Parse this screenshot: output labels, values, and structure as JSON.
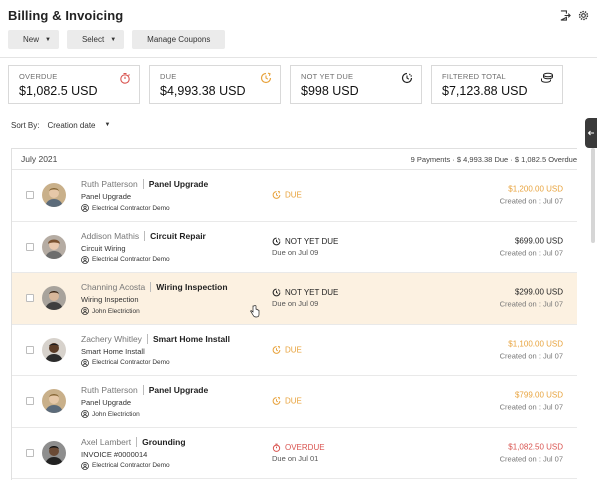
{
  "header": {
    "title": "Billing & Invoicing"
  },
  "toolbar": {
    "new_label": "New",
    "select_label": "Select",
    "coupons_label": "Manage Coupons"
  },
  "summary": [
    {
      "label": "OVERDUE",
      "value": "$1,082.5 USD",
      "icon": "stopwatch-icon",
      "color": "#d9534f"
    },
    {
      "label": "DUE",
      "value": "$4,993.38 USD",
      "icon": "clock-refresh-icon",
      "color": "#e8a33d"
    },
    {
      "label": "NOT YET DUE",
      "value": "$998 USD",
      "icon": "clock-pending-icon",
      "color": "#222222"
    },
    {
      "label": "FILTERED TOTAL",
      "value": "$7,123.88 USD",
      "icon": "coins-stack-icon",
      "color": "#222222"
    }
  ],
  "sort": {
    "label": "Sort By:",
    "value": "Creation date"
  },
  "group": {
    "title": "July 2021",
    "stats": "9 Payments  ·  $ 4,993.38 Due  ·  $ 1,082.5 Overdue"
  },
  "invoices": [
    {
      "name": "Ruth Patterson",
      "job": "Panel Upgrade",
      "sub": "Panel Upgrade",
      "org": "Electrical Contractor Demo",
      "status": "DUE",
      "due_date": "",
      "amount": "$1,200.00 USD",
      "created": "Created on : Jul 07"
    },
    {
      "name": "Addison Mathis",
      "job": "Circuit Repair",
      "sub": "Circuit Wiring",
      "org": "Electrical Contractor Demo",
      "status": "NOT YET DUE",
      "due_date": "Due on Jul 09",
      "amount": "$699.00 USD",
      "created": "Created on : Jul 07"
    },
    {
      "name": "Channing Acosta",
      "job": "Wiring Inspection",
      "sub": "Wiring Inspection",
      "org": "John Electriction",
      "status": "NOT YET DUE",
      "due_date": "Due on Jul 09",
      "amount": "$299.00 USD",
      "created": "Created on : Jul 07"
    },
    {
      "name": "Zachery Whitley",
      "job": "Smart Home Install",
      "sub": "Smart Home Install",
      "org": "Electrical Contractor Demo",
      "status": "DUE",
      "due_date": "",
      "amount": "$1,100.00 USD",
      "created": "Created on : Jul 07"
    },
    {
      "name": "Ruth Patterson",
      "job": "Panel Upgrade",
      "sub": "Panel Upgrade",
      "org": "John Electriction",
      "status": "DUE",
      "due_date": "",
      "amount": "$799.00 USD",
      "created": "Created on : Jul 07"
    },
    {
      "name": "Axel Lambert",
      "job": "Grounding",
      "sub": "INVOICE #0000014",
      "org": "Electrical Contractor Demo",
      "status": "OVERDUE",
      "due_date": "Due on Jul 01",
      "amount": "$1,082.50 USD",
      "created": "Created on : Jul 07"
    }
  ],
  "colors": {
    "due": "#e8a33d",
    "overdue": "#d9534f",
    "hover_row": "#fcf1e1"
  }
}
